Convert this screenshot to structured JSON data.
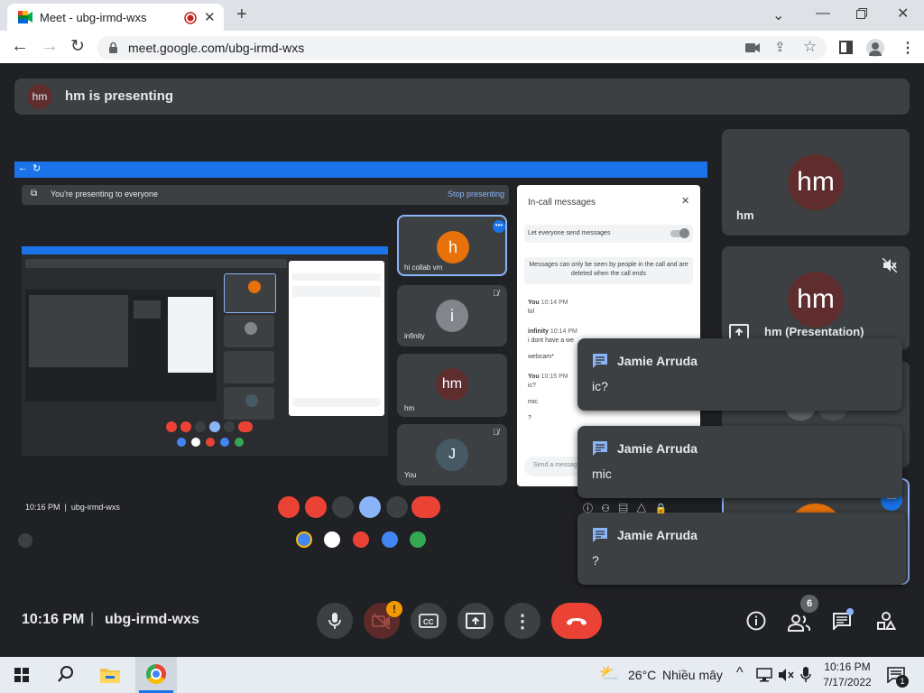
{
  "browser": {
    "tab_title": "Meet - ubg-irmd-wxs",
    "url": "meet.google.com/ubg-irmd-wxs"
  },
  "banner": {
    "avatar": "hm",
    "text": "hm is presenting"
  },
  "shared_screen": {
    "presenting_notice": "You're presenting to everyone",
    "stop_label": "Stop presenting",
    "tiles": [
      {
        "avatar": "h",
        "name": "hi collab vm",
        "color": "#e8710a"
      },
      {
        "avatar": "i",
        "name": "infinity",
        "color": "#80868b"
      },
      {
        "avatar": "hm",
        "name": "hm",
        "color": "#5f2d2d"
      },
      {
        "avatar": "J",
        "name": "You",
        "color": "#455a64"
      }
    ],
    "chat_panel": {
      "title": "In-call messages",
      "toggle_label": "Let everyone send messages",
      "notice": "Messages can only be seen by people in the call and are deleted when the call ends",
      "messages": [
        {
          "sender": "You",
          "time": "10:14 PM",
          "text": "lol"
        },
        {
          "sender": "infinity",
          "time": "10:14 PM",
          "text": "i dont have a we"
        },
        {
          "sender": "",
          "time": "",
          "text": "webcam*"
        },
        {
          "sender": "You",
          "time": "10:15 PM",
          "text": "ic?"
        },
        {
          "sender": "",
          "time": "",
          "text": "mic"
        },
        {
          "sender": "",
          "time": "",
          "text": "?"
        }
      ],
      "input_placeholder": "Send a message"
    },
    "bottom_info": "10:16 PM  |  ubg-irmd-wxs"
  },
  "side_tiles": [
    {
      "avatar": "hm",
      "name": "hm"
    },
    {
      "avatar": "hm",
      "name": "hm (Presentation)"
    }
  ],
  "toasts": [
    {
      "sender": "Jamie Arruda",
      "text": "ic?"
    },
    {
      "sender": "Jamie Arruda",
      "text": "mic"
    },
    {
      "sender": "Jamie Arruda",
      "text": "?"
    }
  ],
  "bottom_bar": {
    "time": "10:16 PM",
    "meeting_code": "ubg-irmd-wxs",
    "participants_count": "6",
    "camera_alert": "!"
  },
  "taskbar": {
    "weather_temp": "26°C",
    "weather_desc": "Nhiều mây",
    "clock_time": "10:16 PM",
    "clock_date": "7/17/2022",
    "notification_count": "1"
  },
  "colors": {
    "meet_bg": "#202124",
    "tile_bg": "#3c4043",
    "end_call": "#ea4335",
    "accent_blue": "#8ab4f8",
    "orange": "#e8710a"
  }
}
